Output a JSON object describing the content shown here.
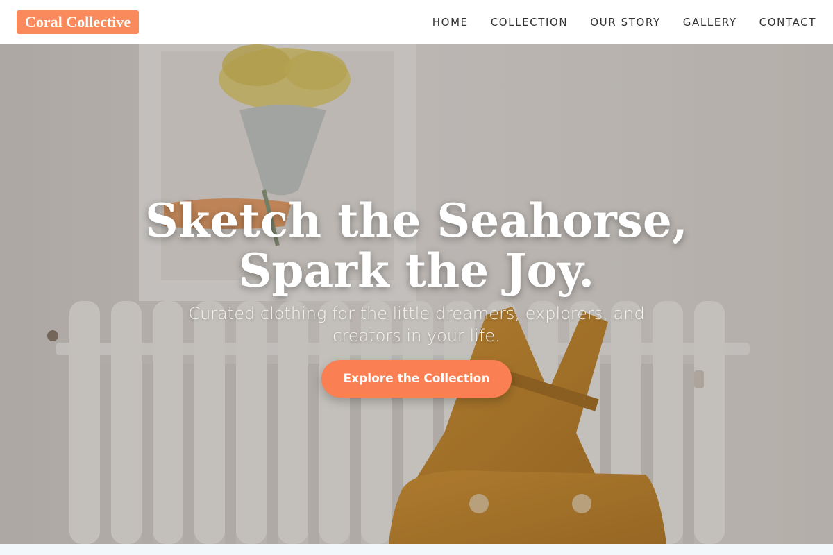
{
  "brand": {
    "name": "Coral Collective",
    "color": "#fa8a5c"
  },
  "nav": {
    "items": [
      {
        "label": "HOME"
      },
      {
        "label": "COLLECTION"
      },
      {
        "label": "OUR STORY"
      },
      {
        "label": "GALLERY"
      },
      {
        "label": "CONTACT"
      }
    ]
  },
  "hero": {
    "title_line1": "Sketch the Seahorse,",
    "title_line2": "Spark the Joy.",
    "subtitle": "Curated clothing for the little dreamers, explorers, and creators in your life.",
    "cta_label": "Explore the Collection",
    "cta_color": "#fa7f53",
    "image": "nursery-radiator-with-mustard-overalls-and-flower-painting"
  }
}
